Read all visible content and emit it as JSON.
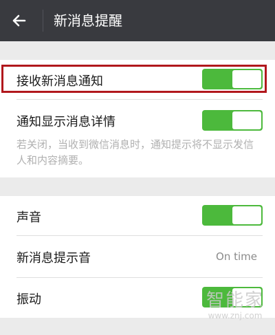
{
  "header": {
    "title": "新消息提醒",
    "back_icon": "arrow-left-icon"
  },
  "settings": {
    "receive_new_message": {
      "label": "接收新消息通知",
      "enabled": true
    },
    "show_message_detail": {
      "label": "通知显示消息详情",
      "enabled": true,
      "note": "若关闭，当收到微信消息时，通知提示将不显示发信人和内容摘要。"
    },
    "sound": {
      "label": "声音",
      "enabled": true
    },
    "ringtone": {
      "label": "新消息提示音",
      "value": "On time"
    },
    "vibrate": {
      "label": "振动",
      "enabled": true
    }
  },
  "watermark": {
    "logo": "智能家",
    "url": "www.znj.com"
  },
  "colors": {
    "header_bg": "#393a3f",
    "toggle_on": "#4cb93c",
    "highlight_border": "#b1171c",
    "section_gap": "#ebebeb"
  }
}
